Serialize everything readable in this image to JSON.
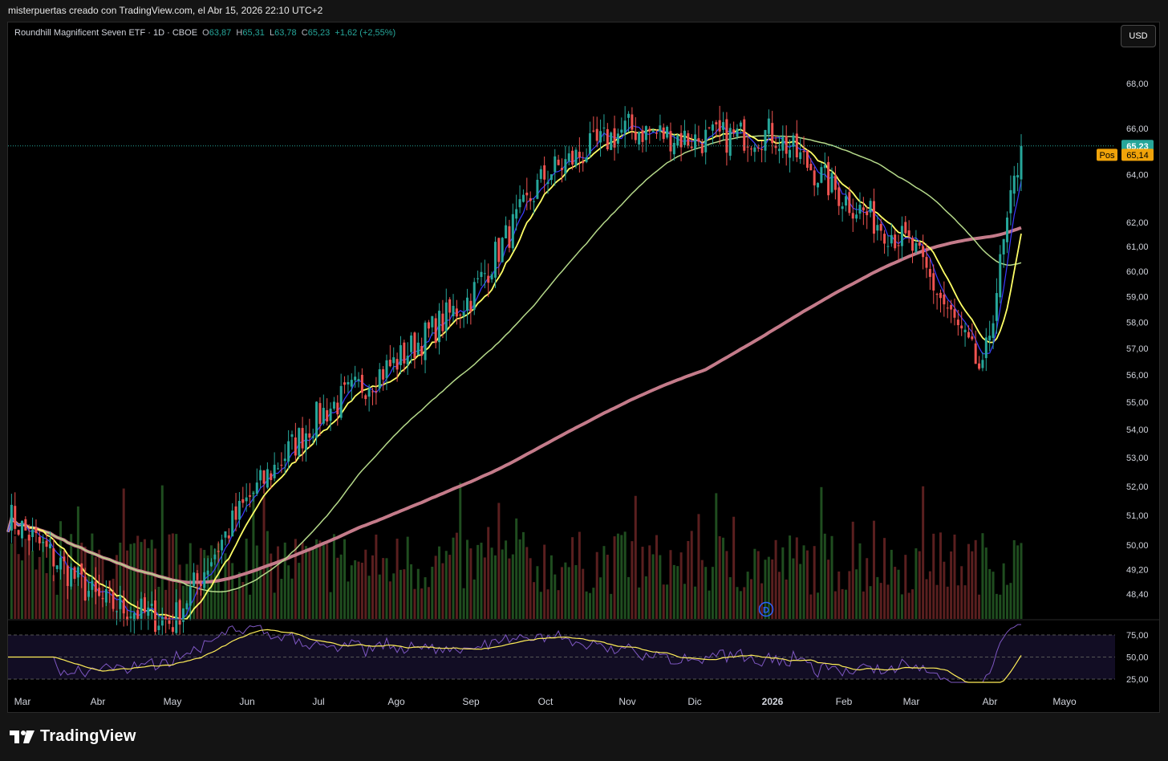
{
  "header": {
    "attribution": "misterpuertas creado con TradingView.com, el Abr 15, 2026 22:10 UTC+2"
  },
  "legend": {
    "symbol": "Roundhill Magnificent Seven ETF · 1D · CBOE",
    "o_label": "O",
    "o_value": "63,87",
    "h_label": "H",
    "h_value": "65,31",
    "l_label": "L",
    "l_value": "63,78",
    "c_label": "C",
    "c_value": "65,23",
    "change": "+1,62 (+2,55%)"
  },
  "currency_button": "USD",
  "brand": {
    "name": "TradingView"
  },
  "price_badges": {
    "last_price": "65,23",
    "pos_label": "Pos",
    "pos_value": "65,14"
  },
  "event_marker": "D",
  "colors": {
    "up": "#26a69a",
    "down": "#ef5350",
    "vol_up": "#1f4d1f",
    "vol_down": "#5a1f1f",
    "ema_fast": "#3b3bff",
    "ema_mid": "#ffff66",
    "sma_50": "#b5d98a",
    "sma_200": "#c47b8a",
    "rsi_line": "#7e57c2",
    "rsi_ma": "#ffee58",
    "price_badge": "#26a69a",
    "pos_badge": "#f0a30a"
  },
  "chart_data": {
    "type": "candlestick",
    "title": "",
    "y_axis_ticks": [
      "68,00",
      "66,00",
      "64,00",
      "62,00",
      "61,00",
      "60,00",
      "59,00",
      "58,00",
      "57,00",
      "56,00",
      "55,00",
      "54,00",
      "53,00",
      "52,00",
      "51,00",
      "50,00",
      "49,20",
      "48,40"
    ],
    "y_scale": "log",
    "ylim": [
      48.0,
      69.0
    ],
    "rsi_ticks": [
      "75,00",
      "50,00",
      "25,00"
    ],
    "x_axis_labels": [
      "Mar",
      "Abr",
      "May",
      "Jun",
      "Jul",
      "Ago",
      "Sep",
      "Oct",
      "Nov",
      "Dic",
      "2026",
      "Feb",
      "Mar",
      "Abr",
      "Mayo"
    ],
    "anchor_points": [
      {
        "label": "Mar",
        "close": 51.0
      },
      {
        "label": "Abr",
        "close": 48.2
      },
      {
        "label": "May",
        "close": 47.5
      },
      {
        "label": "Jun",
        "close": 51.5
      },
      {
        "label": "Jul",
        "close": 54.5
      },
      {
        "label": "Ago",
        "close": 56.5
      },
      {
        "label": "Sep",
        "close": 59.0
      },
      {
        "label": "Oct",
        "close": 64.0
      },
      {
        "label": "Nov",
        "close": 66.0
      },
      {
        "label": "Dic",
        "close": 65.5
      },
      {
        "label": "2026",
        "close": 65.8
      },
      {
        "label": "Feb",
        "close": 63.0
      },
      {
        "label": "Mar",
        "close": 61.0
      },
      {
        "label": "Abr",
        "close": 56.0
      },
      {
        "label": "last",
        "close": 65.23
      }
    ],
    "last": {
      "open": 63.87,
      "high": 65.31,
      "low": 63.78,
      "close": 65.23,
      "change": 1.62,
      "change_pct": 2.55
    },
    "position_price": 65.14,
    "grid": false
  }
}
